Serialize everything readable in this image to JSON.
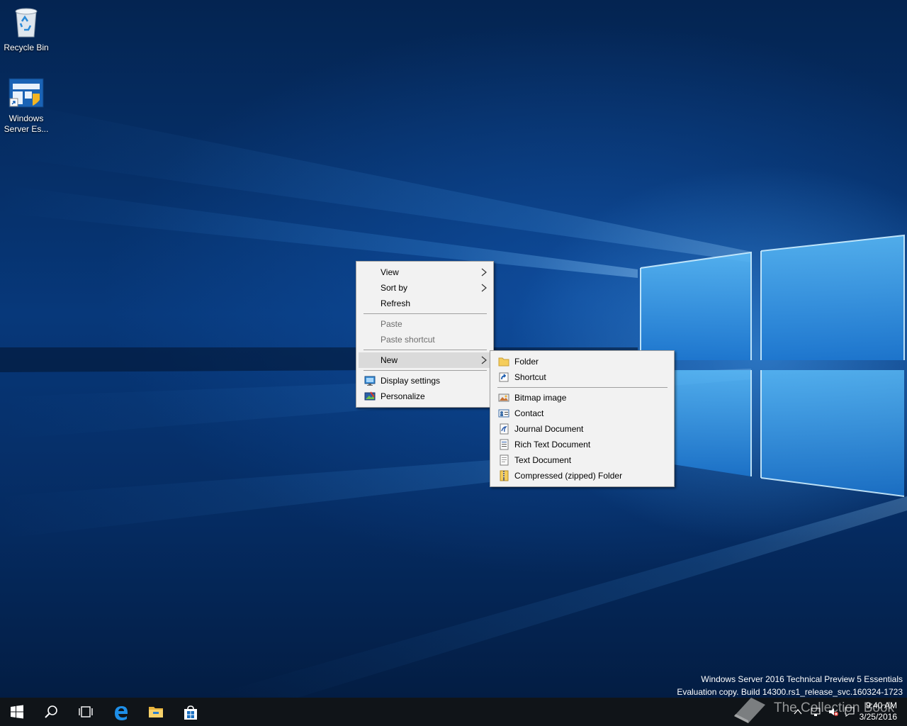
{
  "desktop": {
    "icons": [
      {
        "label": "Recycle Bin",
        "icon": "recycle-bin-icon"
      },
      {
        "label": "Windows Server Es...",
        "label_line1": "Windows",
        "label_line2": "Server Es...",
        "icon": "windows-server-essentials-icon"
      }
    ],
    "evaluation_line1": "Windows Server 2016 Technical Preview 5 Essentials",
    "evaluation_line2": "Evaluation copy. Build 14300.rs1_release_svc.160324-1723"
  },
  "context_menu": {
    "items": [
      {
        "label": "View",
        "submenu": true
      },
      {
        "label": "Sort by",
        "submenu": true
      },
      {
        "label": "Refresh"
      },
      {
        "label": "Paste",
        "disabled": true
      },
      {
        "label": "Paste shortcut",
        "disabled": true
      },
      {
        "label": "New",
        "submenu": true,
        "highlighted": true
      },
      {
        "label": "Display settings",
        "icon": "display-settings-icon"
      },
      {
        "label": "Personalize",
        "icon": "personalize-icon"
      }
    ]
  },
  "new_submenu": {
    "items": [
      {
        "label": "Folder",
        "icon": "folder-icon"
      },
      {
        "label": "Shortcut",
        "icon": "shortcut-icon"
      },
      {
        "label": "Bitmap image",
        "icon": "bitmap-image-icon"
      },
      {
        "label": "Contact",
        "icon": "contact-icon"
      },
      {
        "label": "Journal Document",
        "icon": "journal-document-icon"
      },
      {
        "label": "Rich Text Document",
        "icon": "rich-text-document-icon"
      },
      {
        "label": "Text Document",
        "icon": "text-document-icon"
      },
      {
        "label": "Compressed (zipped) Folder",
        "icon": "zipped-folder-icon"
      }
    ]
  },
  "taskbar": {
    "buttons": [
      "start-icon",
      "search-icon",
      "task-view-icon",
      "edge-icon",
      "file-explorer-icon",
      "store-icon"
    ],
    "clock_time": "9:40 AM",
    "clock_date": "3/25/2016"
  },
  "watermark": "The Collection Book",
  "colors": {
    "desktop_accent": "#0a64c8",
    "menu_bg": "#f2f2f2",
    "menu_highlight": "#dadada",
    "taskbar": "#101418"
  }
}
